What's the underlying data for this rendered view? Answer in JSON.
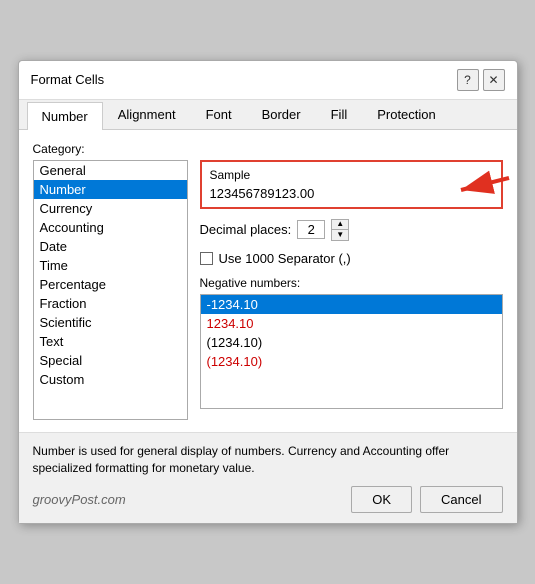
{
  "dialog": {
    "title": "Format Cells",
    "help_btn": "?",
    "close_btn": "✕"
  },
  "tabs": [
    {
      "label": "Number",
      "active": true
    },
    {
      "label": "Alignment",
      "active": false
    },
    {
      "label": "Font",
      "active": false
    },
    {
      "label": "Border",
      "active": false
    },
    {
      "label": "Fill",
      "active": false
    },
    {
      "label": "Protection",
      "active": false
    }
  ],
  "category": {
    "label": "Category:",
    "items": [
      {
        "label": "General",
        "selected": false
      },
      {
        "label": "Number",
        "selected": true
      },
      {
        "label": "Currency",
        "selected": false
      },
      {
        "label": "Accounting",
        "selected": false
      },
      {
        "label": "Date",
        "selected": false
      },
      {
        "label": "Time",
        "selected": false
      },
      {
        "label": "Percentage",
        "selected": false
      },
      {
        "label": "Fraction",
        "selected": false
      },
      {
        "label": "Scientific",
        "selected": false
      },
      {
        "label": "Text",
        "selected": false
      },
      {
        "label": "Special",
        "selected": false
      },
      {
        "label": "Custom",
        "selected": false
      }
    ]
  },
  "sample": {
    "label": "Sample",
    "value": "123456789123.00"
  },
  "decimal": {
    "label": "Decimal places:",
    "value": "2"
  },
  "separator": {
    "label": "Use 1000 Separator (,)"
  },
  "negative": {
    "label": "Negative numbers:",
    "items": [
      {
        "label": "-1234.10",
        "selected": true,
        "color": "white-on-blue"
      },
      {
        "label": "1234.10",
        "selected": false,
        "color": "red"
      },
      {
        "label": "(1234.10)",
        "selected": false,
        "color": "normal"
      },
      {
        "label": "(1234.10)",
        "selected": false,
        "color": "red"
      }
    ]
  },
  "footer": {
    "description": "Number is used for general display of numbers.  Currency and Accounting offer specialized formatting for monetary value.",
    "brand": "groovyPost.com"
  },
  "buttons": {
    "ok": "OK",
    "cancel": "Cancel"
  }
}
